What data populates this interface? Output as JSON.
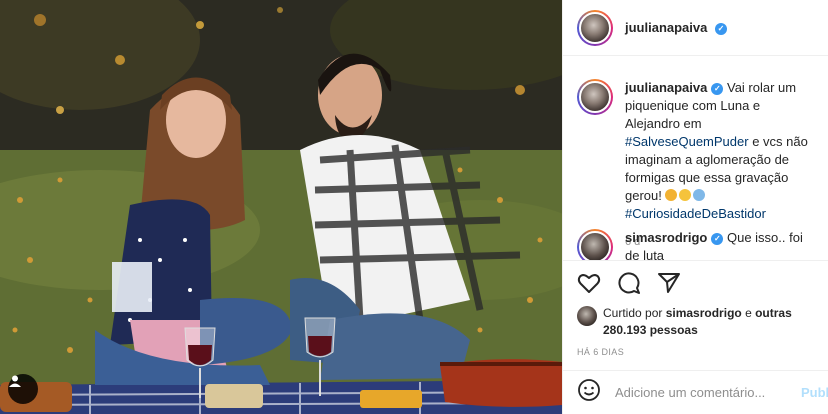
{
  "post": {
    "username": "juulianapaiva",
    "verified": true,
    "caption": {
      "username": "juulianapaiva",
      "text_1": " Vai rolar um piquenique com Luna e Alejandro em ",
      "hashtag_1": "#SalveseQuemPuder",
      "text_2": " e vcs não imaginam a aglomeração de formigas que essa gravação gerou! ",
      "hashtag_2": "#CuriosidadeDeBastidor",
      "time": "6 d"
    },
    "reply": {
      "username": "simasrodrigo",
      "text": " Que isso.. foi de luta"
    },
    "liked_by": {
      "prefix": "Curtido por ",
      "user": "simasrodrigo",
      "middle": " e ",
      "others": "outras 280.193 pessoas"
    },
    "timestamp": "HÁ 6 DIAS"
  },
  "comment_box": {
    "placeholder": "Adicione um comentário...",
    "post_label": "Publicar"
  },
  "icons": {
    "like": "heart-icon",
    "comment": "comment-icon",
    "share": "share-icon",
    "emoji": "emoji-icon",
    "tag": "user-tag-icon",
    "verified": "verified-badge-icon"
  },
  "colors": {
    "verified": "#3897f0",
    "hashtag": "#00376b",
    "post_button": "#b2dffc",
    "muted": "#8e8e8e"
  }
}
